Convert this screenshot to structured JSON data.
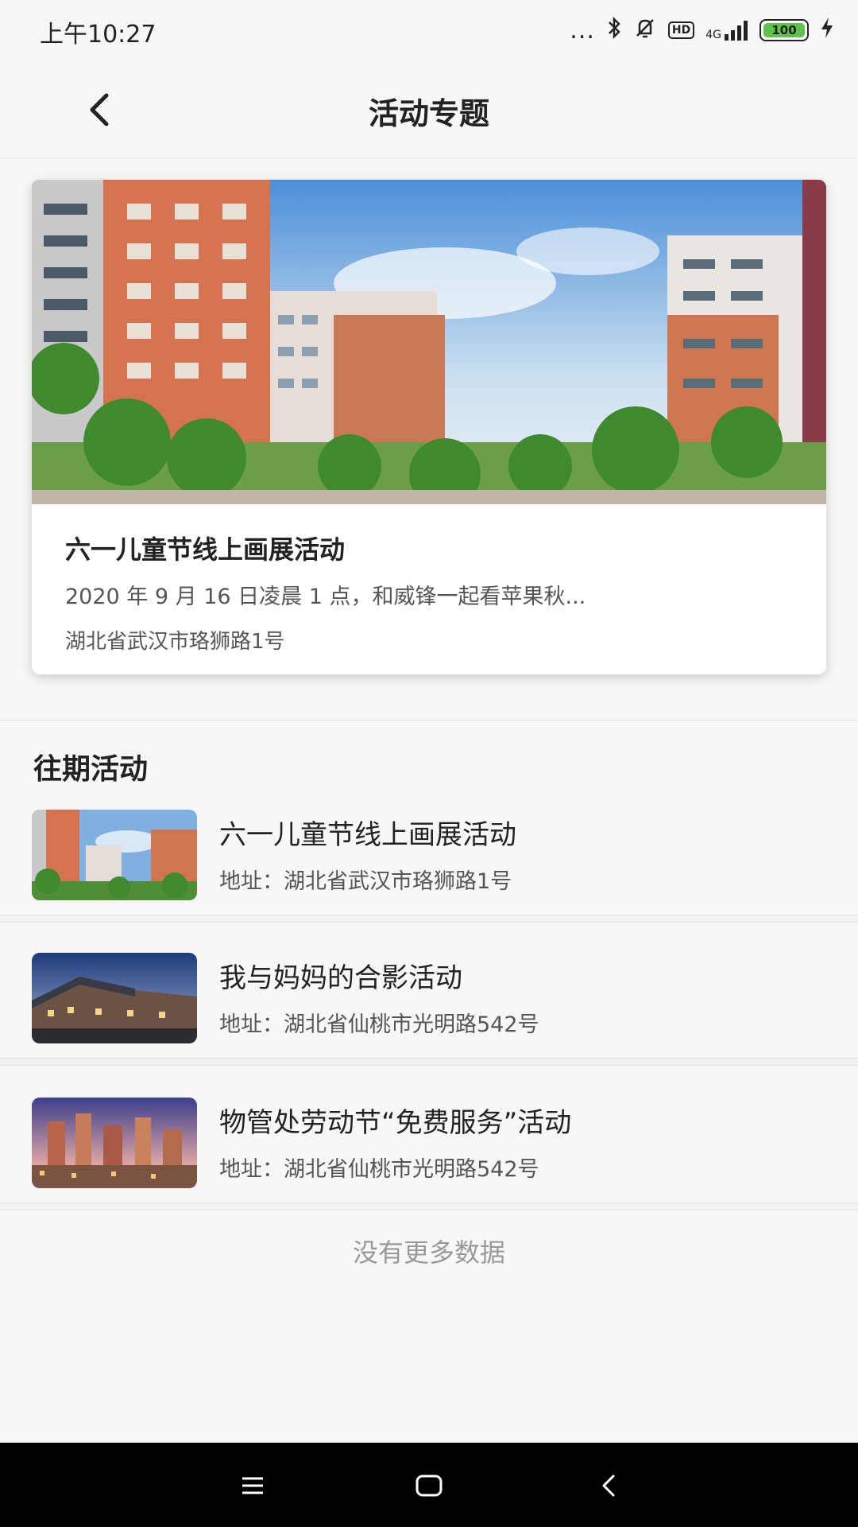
{
  "status_bar": {
    "time": "上午10:27",
    "dots": "...",
    "hd": "HD",
    "network": "4G",
    "battery": "100",
    "icons": [
      "bluetooth-icon",
      "mute-icon",
      "hd-icon",
      "signal-icon",
      "battery-icon",
      "charging-icon"
    ]
  },
  "header": {
    "title": "活动专题",
    "back_icon": "chevron-left-icon"
  },
  "featured": {
    "title": "六一儿童节线上画展活动",
    "description": "2020 年 9 月 16 日凌晨 1 点，和威锋一起看苹果秋...",
    "address": "湖北省武汉市珞狮路1号"
  },
  "past": {
    "section_title": "往期活动",
    "items": [
      {
        "title": "六一儿童节线上画展活动",
        "address": "地址：湖北省武汉市珞狮路1号"
      },
      {
        "title": "我与妈妈的合影活动",
        "address": "地址：湖北省仙桃市光明路542号"
      },
      {
        "title": "物管处劳动节“免费服务”活动",
        "address": "地址：湖北省仙桃市光明路542号"
      }
    ]
  },
  "footer": {
    "no_more": "没有更多数据"
  },
  "system_nav": {
    "icons": [
      "menu-icon",
      "home-icon",
      "back-icon"
    ]
  }
}
